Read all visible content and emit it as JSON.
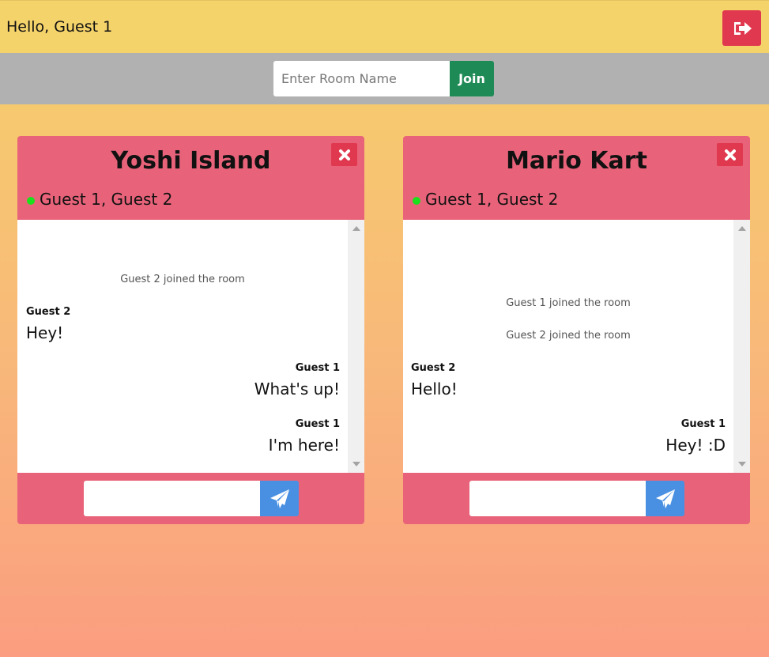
{
  "header": {
    "greeting": "Hello, Guest 1",
    "logout_icon": "sign-out-icon"
  },
  "join": {
    "placeholder": "Enter Room Name",
    "button_label": "Join"
  },
  "rooms": [
    {
      "title": "Yoshi Island",
      "members": "Guest 1, Guest 2",
      "system_messages": [
        "Guest 2 joined the room"
      ],
      "messages": [
        {
          "sender": "Guest 2",
          "text": "Hey!"
        },
        {
          "sender": "Guest 1",
          "text": "What's up!"
        },
        {
          "sender": "Guest 1",
          "text": "I'm here!"
        }
      ]
    },
    {
      "title": "Mario Kart",
      "members": "Guest 1, Guest 2",
      "system_messages": [
        "Guest 1 joined the room",
        "Guest 2 joined the room"
      ],
      "messages": [
        {
          "sender": "Guest 2",
          "text": "Hello!"
        },
        {
          "sender": "Guest 1",
          "text": "Hey! :D"
        }
      ]
    }
  ],
  "colors": {
    "header_bg": "#f5d36b",
    "join_bar_bg": "#b1b1b1",
    "room_bg": "#e8637a",
    "danger": "#e0384e",
    "join_btn": "#1e8a55",
    "send_btn": "#4a90e2",
    "online": "#1de01d"
  }
}
